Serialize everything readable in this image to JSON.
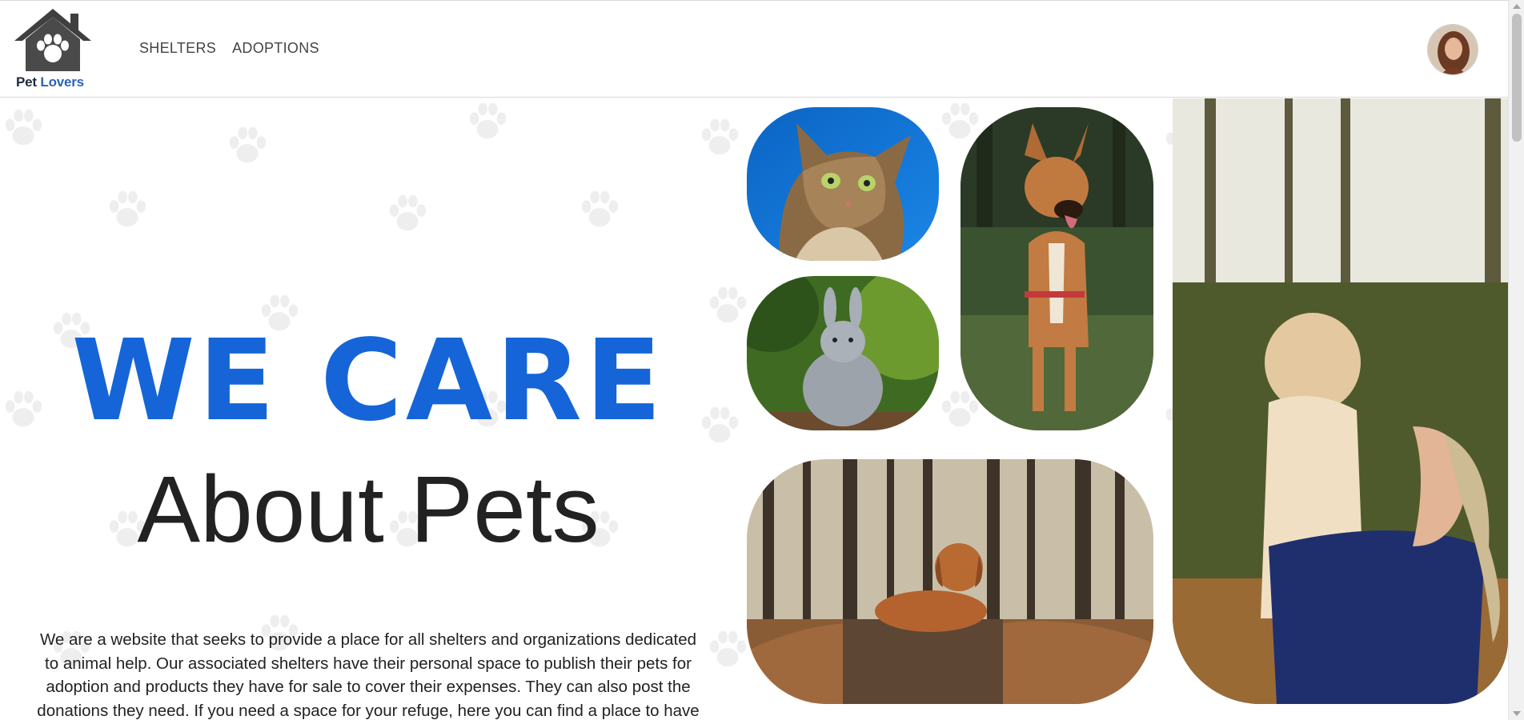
{
  "brand": {
    "name_part1": "Pet",
    "name_part2": "Lovers",
    "logo_icon": "house-paw-icon"
  },
  "nav": {
    "items": [
      {
        "label": "SHELTERS"
      },
      {
        "label": "ADOPTIONS"
      }
    ]
  },
  "user": {
    "avatar_icon": "user-avatar"
  },
  "hero": {
    "headline_1": "WE CARE",
    "headline_2": "About Pets",
    "description": "We are a website that seeks to provide a place for all shelters and organizations dedicated to animal help. Our associated shelters have their personal space to publish their pets for adoption and products they have for sale to cover their expenses. They can also post the donations they need. If you need a space for your refuge, here you can find a place to have",
    "background_icon": "paw-print-icon",
    "photos": [
      {
        "subject": "cat"
      },
      {
        "subject": "rabbit"
      },
      {
        "subject": "dog"
      },
      {
        "subject": "dog-in-forest"
      },
      {
        "subject": "woman-hugging-dog"
      }
    ]
  },
  "colors": {
    "accent": "#1565d8",
    "brand_dark": "#1e2a38",
    "brand_blue": "#2b63b6",
    "paw_gray": "#cfcfcf"
  }
}
